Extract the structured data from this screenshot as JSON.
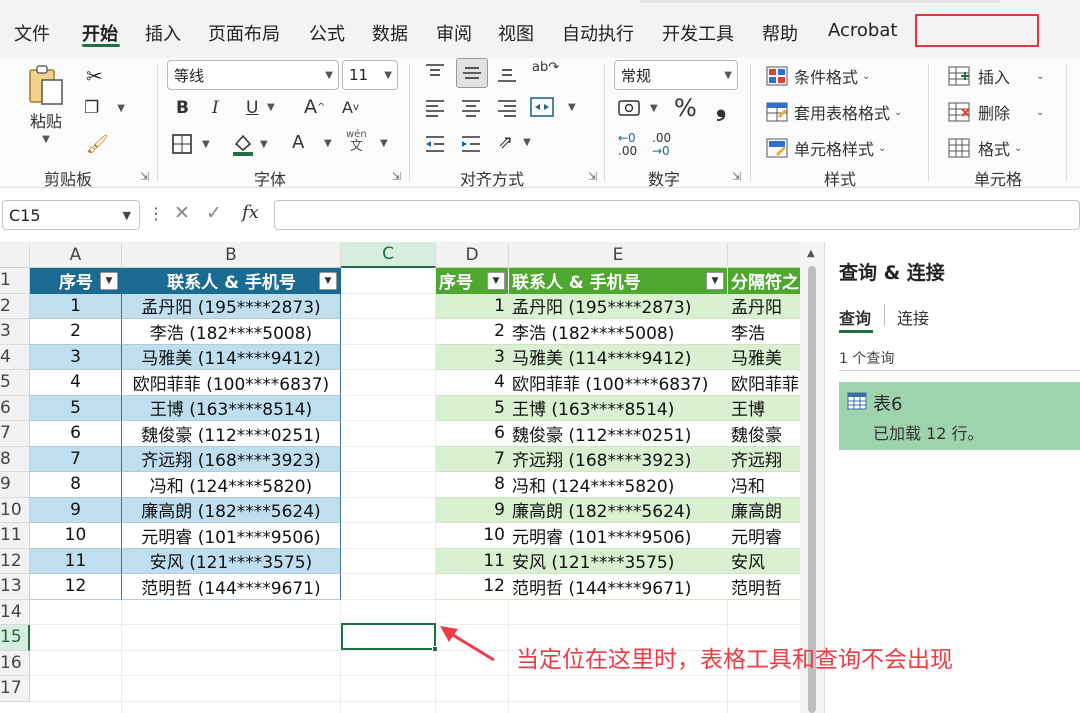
{
  "menu": {
    "tabs": [
      "文件",
      "开始",
      "插入",
      "页面布局",
      "公式",
      "数据",
      "审阅",
      "视图",
      "自动执行",
      "开发工具",
      "帮助",
      "Acrobat"
    ],
    "active": "开始"
  },
  "ribbon": {
    "clipboard": {
      "label": "剪贴板",
      "paste": "粘贴"
    },
    "font": {
      "label": "字体",
      "font_name": "等线",
      "font_size": "11",
      "bold": "B",
      "italic": "I",
      "underline": "U",
      "grow": "A",
      "shrink": "A",
      "font_color": "A",
      "phonetic_top": "wén",
      "phonetic_bottom": "文"
    },
    "alignment": {
      "label": "对齐方式"
    },
    "number": {
      "label": "数字",
      "format": "常规",
      "percent": "%",
      "comma": "❟",
      "inc_decimal_top": "←0",
      "inc_decimal_bottom": ".00",
      "dec_decimal_top": ".00",
      "dec_decimal_bottom": "→0"
    },
    "styles": {
      "label": "样式",
      "conditional": "条件格式",
      "table_format": "套用表格格式",
      "cell_styles": "单元格样式"
    },
    "cells": {
      "label": "单元格",
      "insert": "插入",
      "delete": "删除",
      "format": "格式"
    }
  },
  "formula_bar": {
    "name_box": "C15",
    "fx": "fx",
    "value": ""
  },
  "grid": {
    "columns": [
      "A",
      "B",
      "C",
      "D",
      "E"
    ],
    "selected_column": "C",
    "rows": [
      "1",
      "2",
      "3",
      "4",
      "5",
      "6",
      "7",
      "8",
      "9",
      "10",
      "11",
      "12",
      "13",
      "14",
      "15",
      "16",
      "17"
    ],
    "selected_row": "15",
    "table1": {
      "headers": [
        "序号",
        "联系人 & 手机号"
      ],
      "rows": [
        [
          "1",
          "孟丹阳 (195****2873)"
        ],
        [
          "2",
          "李浩 (182****5008)"
        ],
        [
          "3",
          "马雅美 (114****9412)"
        ],
        [
          "4",
          "欧阳菲菲 (100****6837)"
        ],
        [
          "5",
          "王博 (163****8514)"
        ],
        [
          "6",
          "魏俊豪 (112****0251)"
        ],
        [
          "7",
          "齐远翔 (168****3923)"
        ],
        [
          "8",
          "冯和 (124****5820)"
        ],
        [
          "9",
          "廉高朗 (182****5624)"
        ],
        [
          "10",
          "元明睿 (101****9506)"
        ],
        [
          "11",
          "安风 (121****3575)"
        ],
        [
          "12",
          "范明哲 (144****9671)"
        ]
      ],
      "header_color": "#1b6a93",
      "band_color": "#bfdff1"
    },
    "table2": {
      "headers": [
        "序号",
        "联系人 & 手机号",
        "分隔符之"
      ],
      "rows": [
        [
          "1",
          "孟丹阳 (195****2873)",
          "孟丹阳"
        ],
        [
          "2",
          "李浩 (182****5008)",
          "李浩"
        ],
        [
          "3",
          "马雅美 (114****9412)",
          "马雅美"
        ],
        [
          "4",
          "欧阳菲菲 (100****6837)",
          "欧阳菲菲"
        ],
        [
          "5",
          "王博 (163****8514)",
          "王博"
        ],
        [
          "6",
          "魏俊豪 (112****0251)",
          "魏俊豪"
        ],
        [
          "7",
          "齐远翔 (168****3923)",
          "齐远翔"
        ],
        [
          "8",
          "冯和 (124****5820)",
          "冯和"
        ],
        [
          "9",
          "廉高朗 (182****5624)",
          "廉高朗"
        ],
        [
          "10",
          "元明睿 (101****9506)",
          "元明睿"
        ],
        [
          "11",
          "安风 (121****3575)",
          "安风"
        ],
        [
          "12",
          "范明哲 (144****9671)",
          "范明哲"
        ]
      ],
      "header_color": "#4ea72e",
      "band_color": "#d9f0d1"
    }
  },
  "pane": {
    "title": "查询 & 连接",
    "tabs": [
      "查询",
      "连接"
    ],
    "active_tab": "查询",
    "count": "1 个查询",
    "query": {
      "name": "表6",
      "status": "已加载 12 行。"
    }
  },
  "annotation": {
    "text": "当定位在这里时，表格工具和查询不会出现",
    "color": "#ee3b45"
  }
}
